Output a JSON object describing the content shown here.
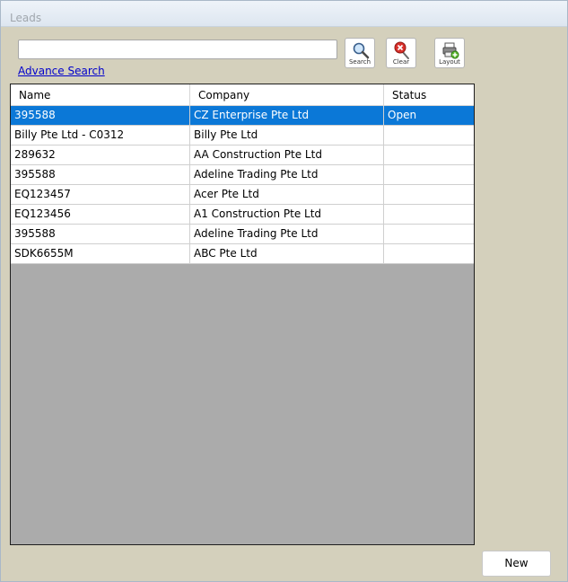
{
  "window": {
    "title": "Leads"
  },
  "search": {
    "value": "",
    "placeholder": "",
    "advance_link": "Advance Search"
  },
  "toolbar": {
    "search_label": "Search",
    "clear_label": "Clear",
    "layout_label": "Layout"
  },
  "grid": {
    "columns": [
      "Name",
      "Company",
      "Status"
    ],
    "rows": [
      {
        "name": "395588",
        "company": "CZ Enterprise Pte Ltd",
        "status": "Open"
      },
      {
        "name": "Billy Pte Ltd - C0312",
        "company": "Billy Pte Ltd",
        "status": ""
      },
      {
        "name": "289632",
        "company": "AA Construction Pte Ltd",
        "status": ""
      },
      {
        "name": "395588",
        "company": "Adeline Trading Pte Ltd",
        "status": ""
      },
      {
        "name": "EQ123457",
        "company": "Acer Pte Ltd",
        "status": ""
      },
      {
        "name": "EQ123456",
        "company": "A1 Construction Pte Ltd",
        "status": ""
      },
      {
        "name": "395588",
        "company": "Adeline Trading Pte Ltd",
        "status": ""
      },
      {
        "name": "SDK6655M",
        "company": "ABC Pte Ltd",
        "status": ""
      }
    ],
    "selected_row": 0
  },
  "footer": {
    "new_label": "New"
  },
  "colors": {
    "window_bg": "#d4d0bc",
    "selection": "#0b78d7",
    "link": "#0000cc",
    "grid_empty": "#ababab"
  },
  "icons": {
    "search": "magnifier-icon",
    "clear": "clear-red-x-icon",
    "layout": "printer-layout-icon"
  }
}
